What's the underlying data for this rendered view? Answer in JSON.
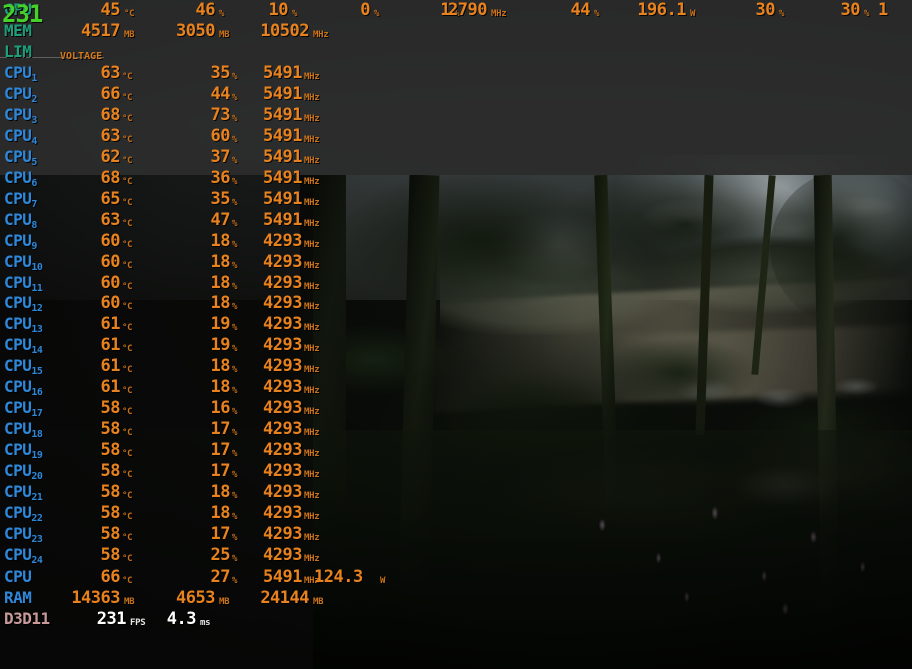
{
  "overlay": {
    "fps_overlay": "231",
    "voltage_tag": "VOLTAGE",
    "colors": {
      "gpu_label": "#1e9e7a",
      "cpu_label": "#2f87d8",
      "d3d_label": "#c89a9a",
      "value": "#e8821e",
      "unit": "#c9721a",
      "fps": "#46d02a",
      "panel": "#2b2b2b"
    }
  },
  "gpu_rows": [
    {
      "label": "GPU",
      "fields": [
        {
          "value": "45",
          "unit": "°C"
        },
        {
          "value": "46",
          "unit": "%"
        },
        {
          "value": "10",
          "unit": "%"
        },
        {
          "value": "0",
          "unit": "%"
        },
        {
          "value": "1",
          "unit": "%"
        },
        {
          "value": "2790",
          "unit": "MHz"
        },
        {
          "value": "44",
          "unit": "%"
        },
        {
          "value": "196.1",
          "unit": "W"
        },
        {
          "value": "30",
          "unit": "%"
        },
        {
          "value": "30",
          "unit": "%"
        },
        {
          "value": "1",
          "unit": ""
        }
      ]
    },
    {
      "label": "MEM",
      "fields": [
        {
          "value": "4517",
          "unit": "MB"
        },
        {
          "value": "3050",
          "unit": "MB"
        },
        {
          "value": "10502",
          "unit": "MHz"
        }
      ]
    },
    {
      "label": "LIM",
      "fields": []
    }
  ],
  "cpu_cores": [
    {
      "label": "CPU",
      "index": "1",
      "temp": "63",
      "load": "35",
      "clock": "5491"
    },
    {
      "label": "CPU",
      "index": "2",
      "temp": "66",
      "load": "44",
      "clock": "5491"
    },
    {
      "label": "CPU",
      "index": "3",
      "temp": "68",
      "load": "73",
      "clock": "5491"
    },
    {
      "label": "CPU",
      "index": "4",
      "temp": "63",
      "load": "60",
      "clock": "5491"
    },
    {
      "label": "CPU",
      "index": "5",
      "temp": "62",
      "load": "37",
      "clock": "5491"
    },
    {
      "label": "CPU",
      "index": "6",
      "temp": "68",
      "load": "36",
      "clock": "5491"
    },
    {
      "label": "CPU",
      "index": "7",
      "temp": "65",
      "load": "35",
      "clock": "5491"
    },
    {
      "label": "CPU",
      "index": "8",
      "temp": "63",
      "load": "47",
      "clock": "5491"
    },
    {
      "label": "CPU",
      "index": "9",
      "temp": "60",
      "load": "18",
      "clock": "4293"
    },
    {
      "label": "CPU",
      "index": "10",
      "temp": "60",
      "load": "18",
      "clock": "4293"
    },
    {
      "label": "CPU",
      "index": "11",
      "temp": "60",
      "load": "18",
      "clock": "4293"
    },
    {
      "label": "CPU",
      "index": "12",
      "temp": "60",
      "load": "18",
      "clock": "4293"
    },
    {
      "label": "CPU",
      "index": "13",
      "temp": "61",
      "load": "19",
      "clock": "4293"
    },
    {
      "label": "CPU",
      "index": "14",
      "temp": "61",
      "load": "19",
      "clock": "4293"
    },
    {
      "label": "CPU",
      "index": "15",
      "temp": "61",
      "load": "18",
      "clock": "4293"
    },
    {
      "label": "CPU",
      "index": "16",
      "temp": "61",
      "load": "18",
      "clock": "4293"
    },
    {
      "label": "CPU",
      "index": "17",
      "temp": "58",
      "load": "16",
      "clock": "4293"
    },
    {
      "label": "CPU",
      "index": "18",
      "temp": "58",
      "load": "17",
      "clock": "4293"
    },
    {
      "label": "CPU",
      "index": "19",
      "temp": "58",
      "load": "17",
      "clock": "4293"
    },
    {
      "label": "CPU",
      "index": "20",
      "temp": "58",
      "load": "17",
      "clock": "4293"
    },
    {
      "label": "CPU",
      "index": "21",
      "temp": "58",
      "load": "18",
      "clock": "4293"
    },
    {
      "label": "CPU",
      "index": "22",
      "temp": "58",
      "load": "18",
      "clock": "4293"
    },
    {
      "label": "CPU",
      "index": "23",
      "temp": "58",
      "load": "17",
      "clock": "4293"
    },
    {
      "label": "CPU",
      "index": "24",
      "temp": "58",
      "load": "25",
      "clock": "4293"
    }
  ],
  "units": {
    "temp": "°C",
    "percent": "%",
    "mhz": "MHz",
    "mb": "MB",
    "watt": "W",
    "fps": "FPS",
    "ms": "ms"
  },
  "summary": {
    "cpu": {
      "label": "CPU",
      "temp": "66",
      "temp_unit": "°C",
      "load": "27",
      "load_unit": "%",
      "clock": "5491",
      "clock_unit": "MHz",
      "power": "124.3",
      "power_unit": "W"
    },
    "ram": {
      "label": "RAM",
      "used": "14363",
      "used_unit": "MB",
      "free": "4653",
      "free_unit": "MB",
      "total": "24144",
      "total_unit": "MB"
    },
    "api": {
      "label": "D3D11",
      "fps": "231",
      "fps_unit": "FPS",
      "frametime": "4.3",
      "frametime_unit": "ms"
    }
  }
}
